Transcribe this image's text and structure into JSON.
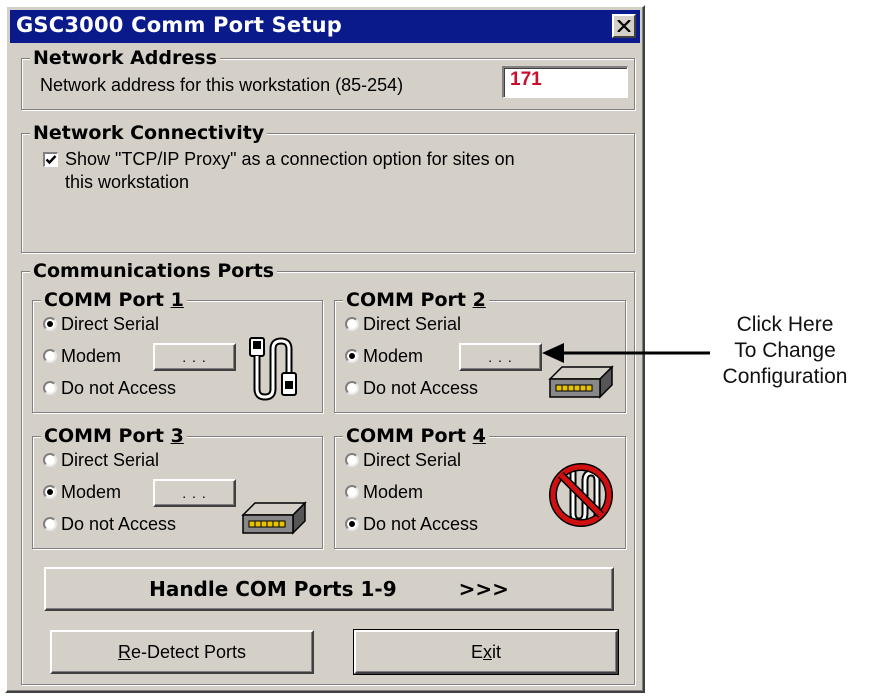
{
  "window": {
    "title": "GSC3000 Comm Port Setup"
  },
  "network_address": {
    "legend": "Network Address",
    "label": "Network address for this workstation (85-254)",
    "value": "171"
  },
  "network_connectivity": {
    "legend": "Network Connectivity",
    "checkbox_checked": true,
    "checkbox_label_line1": "Show \"TCP/IP Proxy\" as a connection option for sites on",
    "checkbox_label_line2": "this workstation"
  },
  "communications_ports": {
    "legend": "Communications Ports",
    "ports": [
      {
        "title": "COMM Port ",
        "number": "1",
        "options": [
          "Direct Serial",
          "Modem",
          "Do not Access"
        ],
        "selected": "Direct Serial",
        "config_button": ". . .",
        "icon": "serial-cable-icon"
      },
      {
        "title": "COMM Port ",
        "number": "2",
        "options": [
          "Direct Serial",
          "Modem",
          "Do not Access"
        ],
        "selected": "Modem",
        "config_button": ". . .",
        "icon": "modem-icon"
      },
      {
        "title": "COMM Port ",
        "number": "3",
        "options": [
          "Direct Serial",
          "Modem",
          "Do not Access"
        ],
        "selected": "Modem",
        "config_button": ". . .",
        "icon": "modem-icon"
      },
      {
        "title": "COMM Port ",
        "number": "4",
        "options": [
          "Direct Serial",
          "Modem",
          "Do not Access"
        ],
        "selected": "Do not Access",
        "icon": "no-access-icon"
      }
    ]
  },
  "buttons": {
    "handle_com": "Handle COM Ports 1-9",
    "handle_com_arrows": ">>>",
    "redetect_first": "R",
    "redetect_rest": "e-Detect Ports",
    "exit_first": "E",
    "exit_mid": "x",
    "exit_rest": "it"
  },
  "annotation": {
    "line1": "Click Here",
    "line2": "To Change",
    "line3": "Configuration"
  },
  "colors": {
    "title_bar": "#0a1a8a",
    "dialog": "#d4d0c8",
    "value_text": "#c8102e",
    "modem_light": "#e6c200",
    "no_access": "#d01010"
  }
}
